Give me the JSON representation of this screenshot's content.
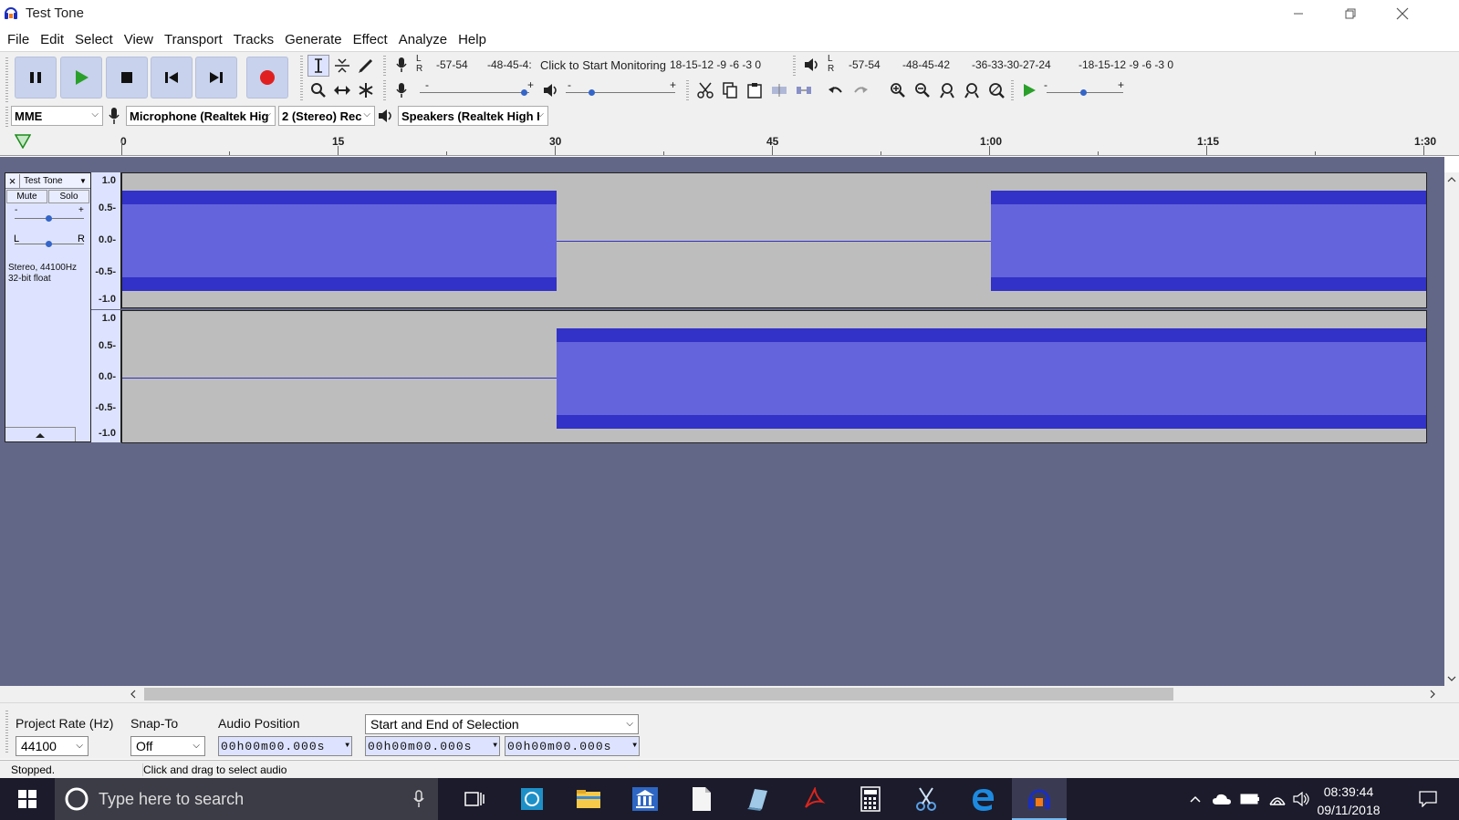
{
  "window": {
    "title": "Test Tone"
  },
  "menu": [
    "File",
    "Edit",
    "Select",
    "View",
    "Transport",
    "Tracks",
    "Generate",
    "Effect",
    "Analyze",
    "Help"
  ],
  "meters": {
    "record_scale_left": "-57-54",
    "record_scale_mid": "-48-45-4:",
    "record_monitor_text": "Click to Start Monitoring",
    "record_scale_right": "18-15-12 -9 -6 -3 0",
    "play_scale_1": "-57-54",
    "play_scale_2": "-48-45-42",
    "play_scale_3": "-36-33-30-27-24",
    "play_scale_4": "-18-15-12 -9 -6 -3 0",
    "lr_l": "L",
    "lr_r": "R",
    "slider_minus": "-",
    "slider_plus": "+"
  },
  "device": {
    "host": "MME",
    "recording_device": "Microphone (Realtek Hig",
    "channels": "2 (Stereo) Rec",
    "playback_device": "Speakers (Realtek High I"
  },
  "timeline": {
    "ticks": [
      "0",
      "15",
      "30",
      "45",
      "1:00",
      "1:15",
      "1:30"
    ]
  },
  "track": {
    "name": "Test Tone",
    "close": "×",
    "mute": "Mute",
    "solo": "Solo",
    "gain_minus": "-",
    "gain_plus": "+",
    "pan_l": "L",
    "pan_r": "R",
    "info_line1": "Stereo, 44100Hz",
    "info_line2": "32-bit float",
    "amplitude_labels": [
      "1.0",
      "0.5-",
      "0.0-",
      "-0.5-",
      "-1.0"
    ]
  },
  "selection_toolbar": {
    "project_rate_label": "Project Rate (Hz)",
    "project_rate_value": "44100",
    "snap_to_label": "Snap-To",
    "snap_to_value": "Off",
    "audio_position_label": "Audio Position",
    "audio_position_value": "00h00m00.000s",
    "selection_mode": "Start and End of Selection",
    "selection_start": "00h00m00.000s",
    "selection_end": "00h00m00.000s"
  },
  "status": {
    "state": "Stopped.",
    "hint": "Click and drag to select audio"
  },
  "taskbar": {
    "search_placeholder": "Type here to search",
    "time": "08:39:44",
    "date": "09/11/2018"
  },
  "colors": {
    "waveform_fill": "#6464dc",
    "waveform_edge": "#3232c8",
    "track_background": "#636787",
    "record_red": "#e02020",
    "play_green": "#2aa02a"
  }
}
